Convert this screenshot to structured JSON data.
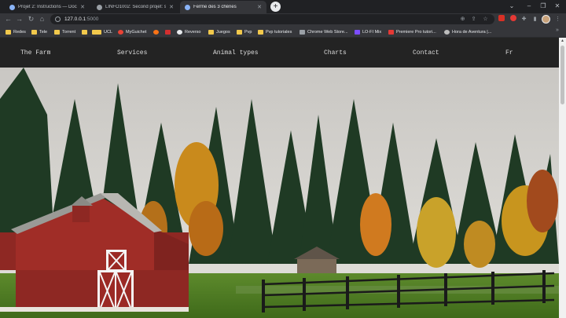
{
  "browser": {
    "tabs": [
      {
        "label": "Projet 2: Instructions — Docume...",
        "active": false,
        "favicon_color": "#8ab4f8"
      },
      {
        "label": "LINFO1002: Second projet: sour...",
        "active": false,
        "favicon_color": "#9aa0a6"
      },
      {
        "label": "Ferme des 3 chênes",
        "active": true,
        "favicon_color": "#8ab4f8"
      }
    ],
    "new_tab_label": "+",
    "window_controls": {
      "minimize": "–",
      "maximize": "❐",
      "close": "✕",
      "collapse": "⌄"
    },
    "nav": {
      "back": "←",
      "forward": "→",
      "reload": "↻",
      "home": "⌂"
    },
    "address": {
      "host": "127.0.0.1",
      "port": ":5000"
    },
    "toolbar_icons": [
      "zoom-icon",
      "share-icon",
      "star-icon",
      "extension-red-icon",
      "extension-puzzle-icon",
      "sidebar-icon"
    ],
    "bookmarks": [
      {
        "label": "Redes",
        "icon": "folder"
      },
      {
        "label": "Tele",
        "icon": "folder"
      },
      {
        "label": "Torrent",
        "icon": "folder"
      },
      {
        "label": "",
        "icon": "folder"
      },
      {
        "label": "",
        "icon": "folder"
      },
      {
        "label": "UCL",
        "icon": "folder"
      },
      {
        "label": "MyGuichet",
        "icon": "site"
      },
      {
        "label": "",
        "icon": "site"
      },
      {
        "label": "",
        "icon": "site"
      },
      {
        "label": "Reverso",
        "icon": "site"
      },
      {
        "label": "Juegos",
        "icon": "folder"
      },
      {
        "label": "Pvp",
        "icon": "folder"
      },
      {
        "label": "Pvp tutoriales",
        "icon": "folder"
      },
      {
        "label": "Chrome Web Store...",
        "icon": "site"
      },
      {
        "label": "LO-FI Mix",
        "icon": "site"
      },
      {
        "label": "Premiere Pro tutori...",
        "icon": "site"
      },
      {
        "label": "Hora de Aventura |...",
        "icon": "site"
      }
    ],
    "bookmarks_more": "»"
  },
  "site": {
    "nav": [
      "The Farm",
      "Services",
      "Animal types",
      "Charts",
      "Contact",
      "Fr"
    ]
  },
  "colors": {
    "nav_bg": "#232323",
    "nav_text": "#dcdcdc",
    "barn_red": "#9b2a25",
    "grass": "#4f7a22"
  }
}
